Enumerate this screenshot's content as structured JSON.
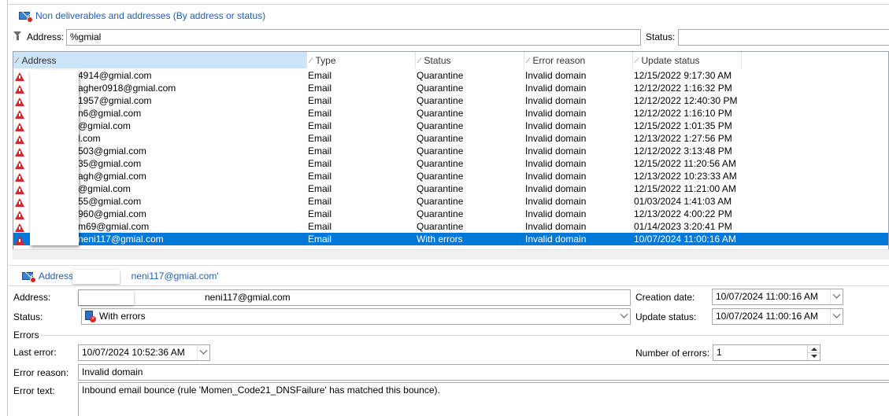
{
  "header": {
    "title": "Non deliverables and addresses (By address or status)"
  },
  "filter": {
    "address_label": "Address:",
    "address_value": "%gmial",
    "status_label": "Status:",
    "status_value": ""
  },
  "grid": {
    "columns": [
      "Address",
      "Type",
      "Status",
      "Error reason",
      "Update status"
    ],
    "rows": [
      {
        "address": "4914@gmial.com",
        "type": "Email",
        "status": "Quarantine",
        "reason": "Invalid domain",
        "updated": "12/15/2022 9:17:30 AM"
      },
      {
        "address": "agher0918@gmial.com",
        "type": "Email",
        "status": "Quarantine",
        "reason": "Invalid domain",
        "updated": "12/12/2022 1:16:32 PM"
      },
      {
        "address": "1957@gmial.com",
        "type": "Email",
        "status": "Quarantine",
        "reason": "Invalid domain",
        "updated": "12/12/2022 12:40:30 PM"
      },
      {
        "address": "n6@gmial.com",
        "type": "Email",
        "status": "Quarantine",
        "reason": "Invalid domain",
        "updated": "12/12/2022 1:16:10 PM"
      },
      {
        "address": "@gmial.com",
        "type": "Email",
        "status": "Quarantine",
        "reason": "Invalid domain",
        "updated": "12/15/2022 1:01:35 PM"
      },
      {
        "address": "l.com",
        "type": "Email",
        "status": "Quarantine",
        "reason": "Invalid domain",
        "updated": "12/13/2022 1:27:56 PM"
      },
      {
        "address": "503@gmial.com",
        "type": "Email",
        "status": "Quarantine",
        "reason": "Invalid domain",
        "updated": "12/12/2022 3:13:48 PM"
      },
      {
        "address": "35@gmial.com",
        "type": "Email",
        "status": "Quarantine",
        "reason": "Invalid domain",
        "updated": "12/15/2022 11:20:56 AM"
      },
      {
        "address": "agh@gmial.com",
        "type": "Email",
        "status": "Quarantine",
        "reason": "Invalid domain",
        "updated": "12/13/2022 10:23:33 AM"
      },
      {
        "address": "@gmial.com",
        "type": "Email",
        "status": "Quarantine",
        "reason": "Invalid domain",
        "updated": "12/15/2022 11:21:00 AM"
      },
      {
        "address": "55@gmial.com",
        "type": "Email",
        "status": "Quarantine",
        "reason": "Invalid domain",
        "updated": "01/03/2024 1:41:03 AM"
      },
      {
        "address": "960@gmial.com",
        "type": "Email",
        "status": "Quarantine",
        "reason": "Invalid domain",
        "updated": "12/13/2022 4:00:22 PM"
      },
      {
        "address": "m69@gmial.com",
        "type": "Email",
        "status": "Quarantine",
        "reason": "Invalid domain",
        "updated": "01/14/2023 3:20:41 PM"
      },
      {
        "address": "neni117@gmial.com",
        "type": "Email",
        "status": "With errors",
        "reason": "Invalid domain",
        "updated": "10/07/2024 11:00:16 AM"
      }
    ]
  },
  "detail": {
    "title_prefix": "Address '",
    "title_suffix": "neni117@gmial.com'",
    "address_label": "Address:",
    "address_value": "neni117@gmial.com",
    "creation_label": "Creation date:",
    "creation_value": "10/07/2024 11:00:16 AM",
    "status_label": "Status:",
    "status_value": "With errors",
    "update_label": "Update status:",
    "update_value": "10/07/2024 11:00:16 AM",
    "errors_group": "Errors",
    "last_error_label": "Last error:",
    "last_error_value": "10/07/2024 10:52:36 AM",
    "num_errors_label": "Number of errors:",
    "num_errors_value": "1",
    "error_reason_label": "Error reason:",
    "error_reason_value": "Invalid domain",
    "error_text_label": "Error text:",
    "error_text_value": "Inbound email bounce (rule 'Momen_Code21_DNSFailure' has matched this bounce)."
  },
  "icons": {
    "title": "mail-error-icon",
    "filter": "filter-icon",
    "row_quarantine": "warning-triangle-icon",
    "status": "error-status-icon"
  },
  "colors": {
    "title_blue": "#1f5fa8",
    "selection": "#0078d7",
    "header_selected": "#cce4f7",
    "warning_red": "#d5262a"
  }
}
